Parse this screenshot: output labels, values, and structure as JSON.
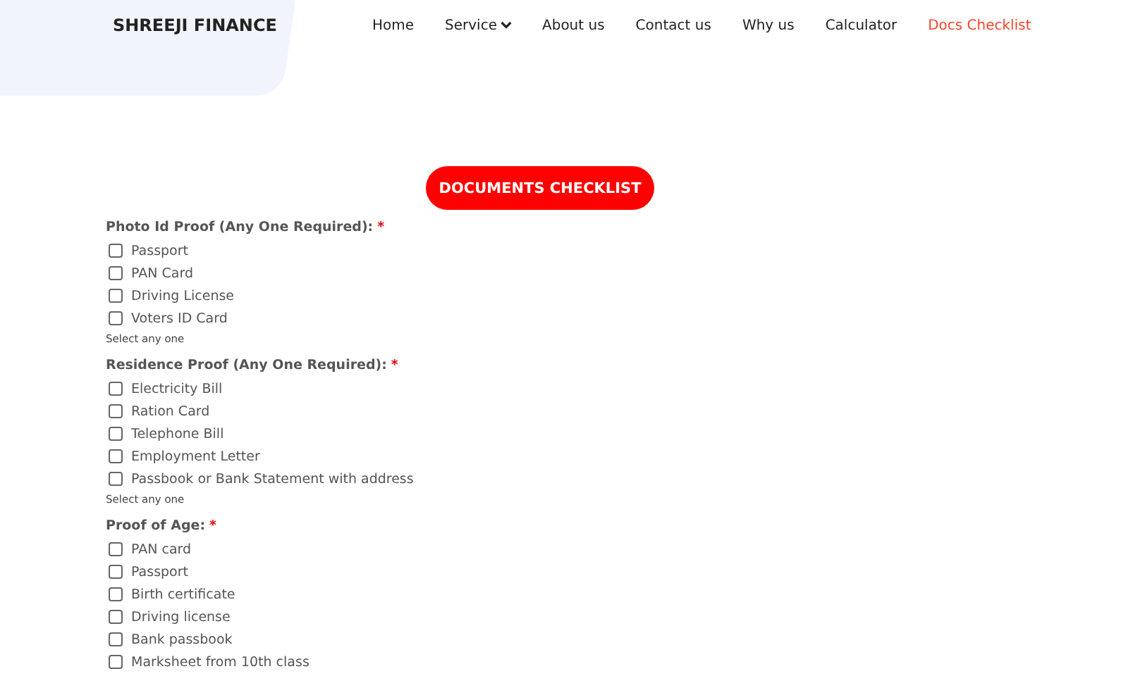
{
  "brand": "SHREEJI FINANCE",
  "nav": [
    {
      "label": "Home",
      "selected": false,
      "dropdown": false
    },
    {
      "label": "Service",
      "selected": false,
      "dropdown": true
    },
    {
      "label": "About us",
      "selected": false,
      "dropdown": false
    },
    {
      "label": "Contact us",
      "selected": false,
      "dropdown": false
    },
    {
      "label": "Why us",
      "selected": false,
      "dropdown": false
    },
    {
      "label": "Calculator",
      "selected": false,
      "dropdown": false
    },
    {
      "label": "Docs Checklist",
      "selected": true,
      "dropdown": false
    }
  ],
  "title_button": "DOCUMENTS CHECKLIST",
  "sections": [
    {
      "label": "Photo Id Proof (Any One Required):",
      "mark": "*",
      "hint": "Select any one",
      "options": [
        {
          "label": "Passport",
          "checked": false
        },
        {
          "label": "PAN Card",
          "checked": false
        },
        {
          "label": "Driving License",
          "checked": false
        },
        {
          "label": "Voters ID Card",
          "checked": false
        }
      ]
    },
    {
      "label": "Residence Proof (Any One Required):",
      "mark": "*",
      "hint": "Select any one",
      "options": [
        {
          "label": "Electricity Bill",
          "checked": false
        },
        {
          "label": "Ration Card",
          "checked": false
        },
        {
          "label": "Telephone Bill",
          "checked": false
        },
        {
          "label": "Employment Letter",
          "checked": false
        },
        {
          "label": "Passbook or Bank Statement with address",
          "checked": false
        }
      ]
    },
    {
      "label": "Proof of Age:",
      "mark": "*",
      "options": [
        {
          "label": "PAN card",
          "checked": false
        },
        {
          "label": "Passport",
          "checked": false
        },
        {
          "label": "Birth certificate",
          "checked": false
        },
        {
          "label": "Driving license",
          "checked": false
        },
        {
          "label": "Bank passbook",
          "checked": false
        },
        {
          "label": "Marksheet from 10th class",
          "checked": false
        }
      ]
    }
  ]
}
